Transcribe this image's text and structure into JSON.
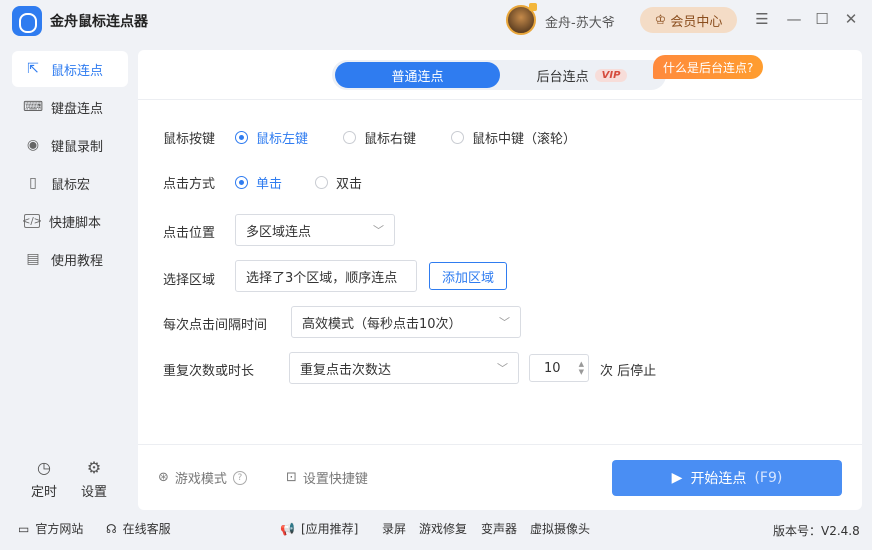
{
  "app": {
    "title": "金舟鼠标连点器"
  },
  "user": {
    "name": "金舟-苏大爷",
    "member_label": "会员中心"
  },
  "window_controls": {
    "menu_icon": "menu-icon",
    "min_icon": "minimize-icon",
    "max_icon": "maximize-icon",
    "close_icon": "close-icon"
  },
  "sidebar": {
    "items": [
      {
        "label": "鼠标连点",
        "icon": "mouse-click-icon",
        "active": true
      },
      {
        "label": "键盘连点",
        "icon": "keyboard-icon",
        "active": false
      },
      {
        "label": "键鼠录制",
        "icon": "webcam-icon",
        "active": false
      },
      {
        "label": "鼠标宏",
        "icon": "mouse-icon",
        "active": false
      },
      {
        "label": "快捷脚本",
        "icon": "code-icon",
        "active": false
      },
      {
        "label": "使用教程",
        "icon": "document-icon",
        "active": false
      }
    ],
    "bottom": [
      {
        "label": "定时",
        "icon": "timer-icon"
      },
      {
        "label": "设置",
        "icon": "sliders-icon"
      }
    ]
  },
  "tabs": {
    "normal": "普通连点",
    "background": "后台连点",
    "vip_badge": "VIP",
    "bg_tip": "什么是后台连点?"
  },
  "form": {
    "mouse_button": {
      "label": "鼠标按键",
      "options": [
        "鼠标左键",
        "鼠标右键",
        "鼠标中键（滚轮）"
      ],
      "selected": 0
    },
    "click_mode": {
      "label": "点击方式",
      "options": [
        "单击",
        "双击"
      ],
      "selected": 0
    },
    "click_position": {
      "label": "点击位置",
      "value": "多区域连点"
    },
    "select_area": {
      "label": "选择区域",
      "value": "选择了3个区域，顺序连点",
      "add_button": "添加区域"
    },
    "interval": {
      "label": "每次点击间隔时间",
      "value": "高效模式（每秒点击10次）"
    },
    "repeat": {
      "label": "重复次数或时长",
      "mode": "重复点击次数达",
      "count": "10",
      "suffix": "次 后停止"
    }
  },
  "footer": {
    "game_mode": "游戏模式",
    "shortcut": "设置快捷键",
    "start_button": "开始连点",
    "start_hotkey": "(F9)"
  },
  "status_bar": {
    "website": "官方网站",
    "support": "在线客服",
    "recommend": "[应用推荐]",
    "links": [
      "录屏",
      "游戏修复",
      "变声器",
      "虚拟摄像头"
    ],
    "version": "版本号：V2.4.8"
  },
  "colors": {
    "accent": "#2f7cf0",
    "member_bg": "#f4dcc6",
    "tip_orange": "#ff8a3d",
    "vip_red": "#d54b3c"
  }
}
